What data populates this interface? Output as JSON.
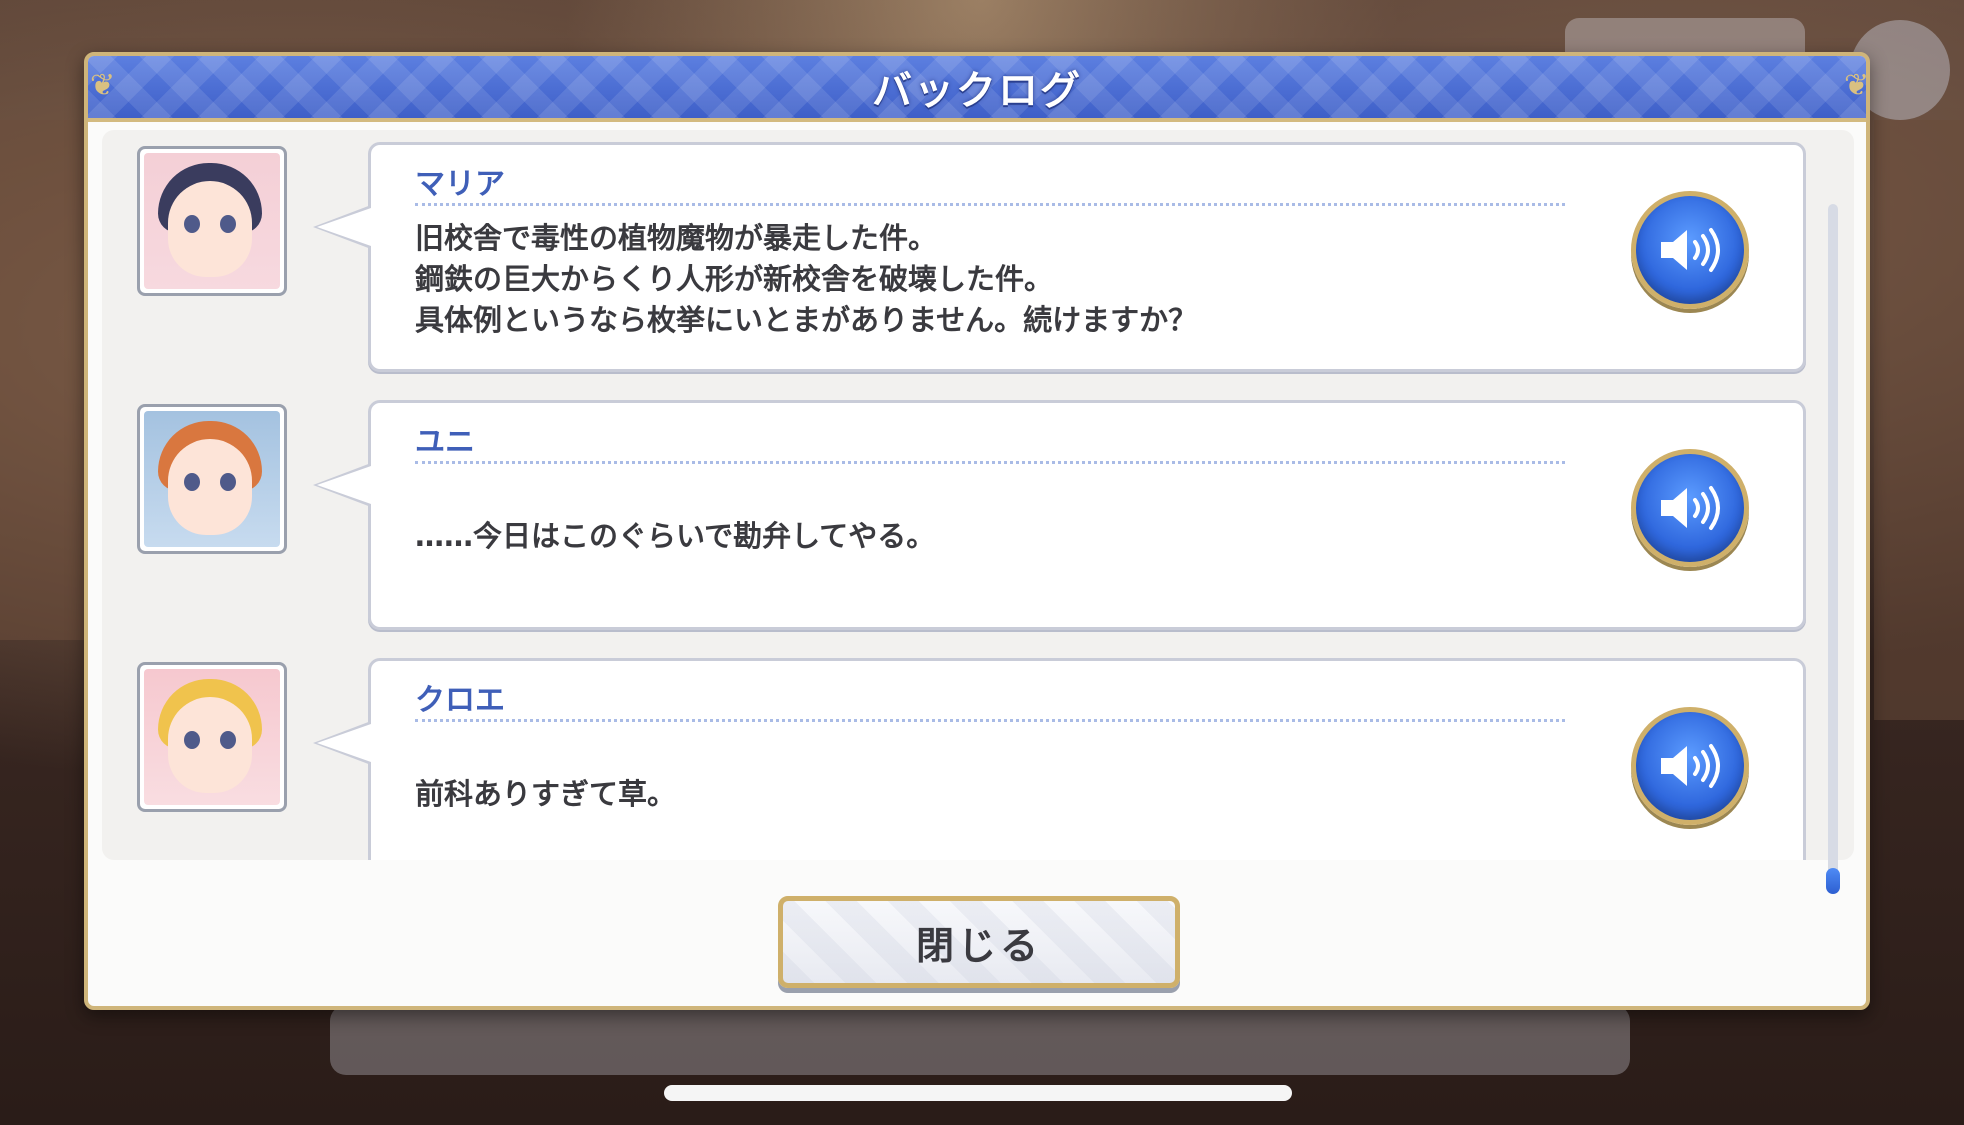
{
  "dialog": {
    "title": "バックログ",
    "close_label": "閉じる"
  },
  "entries": [
    {
      "speaker": "マリア",
      "lines": [
        "旧校舎で毒性の植物魔物が暴走した件。",
        "鋼鉄の巨大からくり人形が新校舎を破壊した件。",
        "具体例というなら枚挙にいとまがありません。続けますか？"
      ],
      "avatar_icon": "maria-portrait",
      "voice_icon": "speaker-icon"
    },
    {
      "speaker": "ユニ",
      "lines": [
        "……今日はこのぐらいで勘弁してやる。"
      ],
      "avatar_icon": "yuni-portrait",
      "voice_icon": "speaker-icon"
    },
    {
      "speaker": "クロエ",
      "lines": [
        "前科ありすぎて草。"
      ],
      "avatar_icon": "chloe-portrait",
      "voice_icon": "speaker-icon"
    }
  ],
  "colors": {
    "title_bar": "#3e5fc8",
    "speaker_name": "#3f5fb8",
    "frame_gold": "#cfb57a",
    "voice_button": "#2f67dd"
  }
}
